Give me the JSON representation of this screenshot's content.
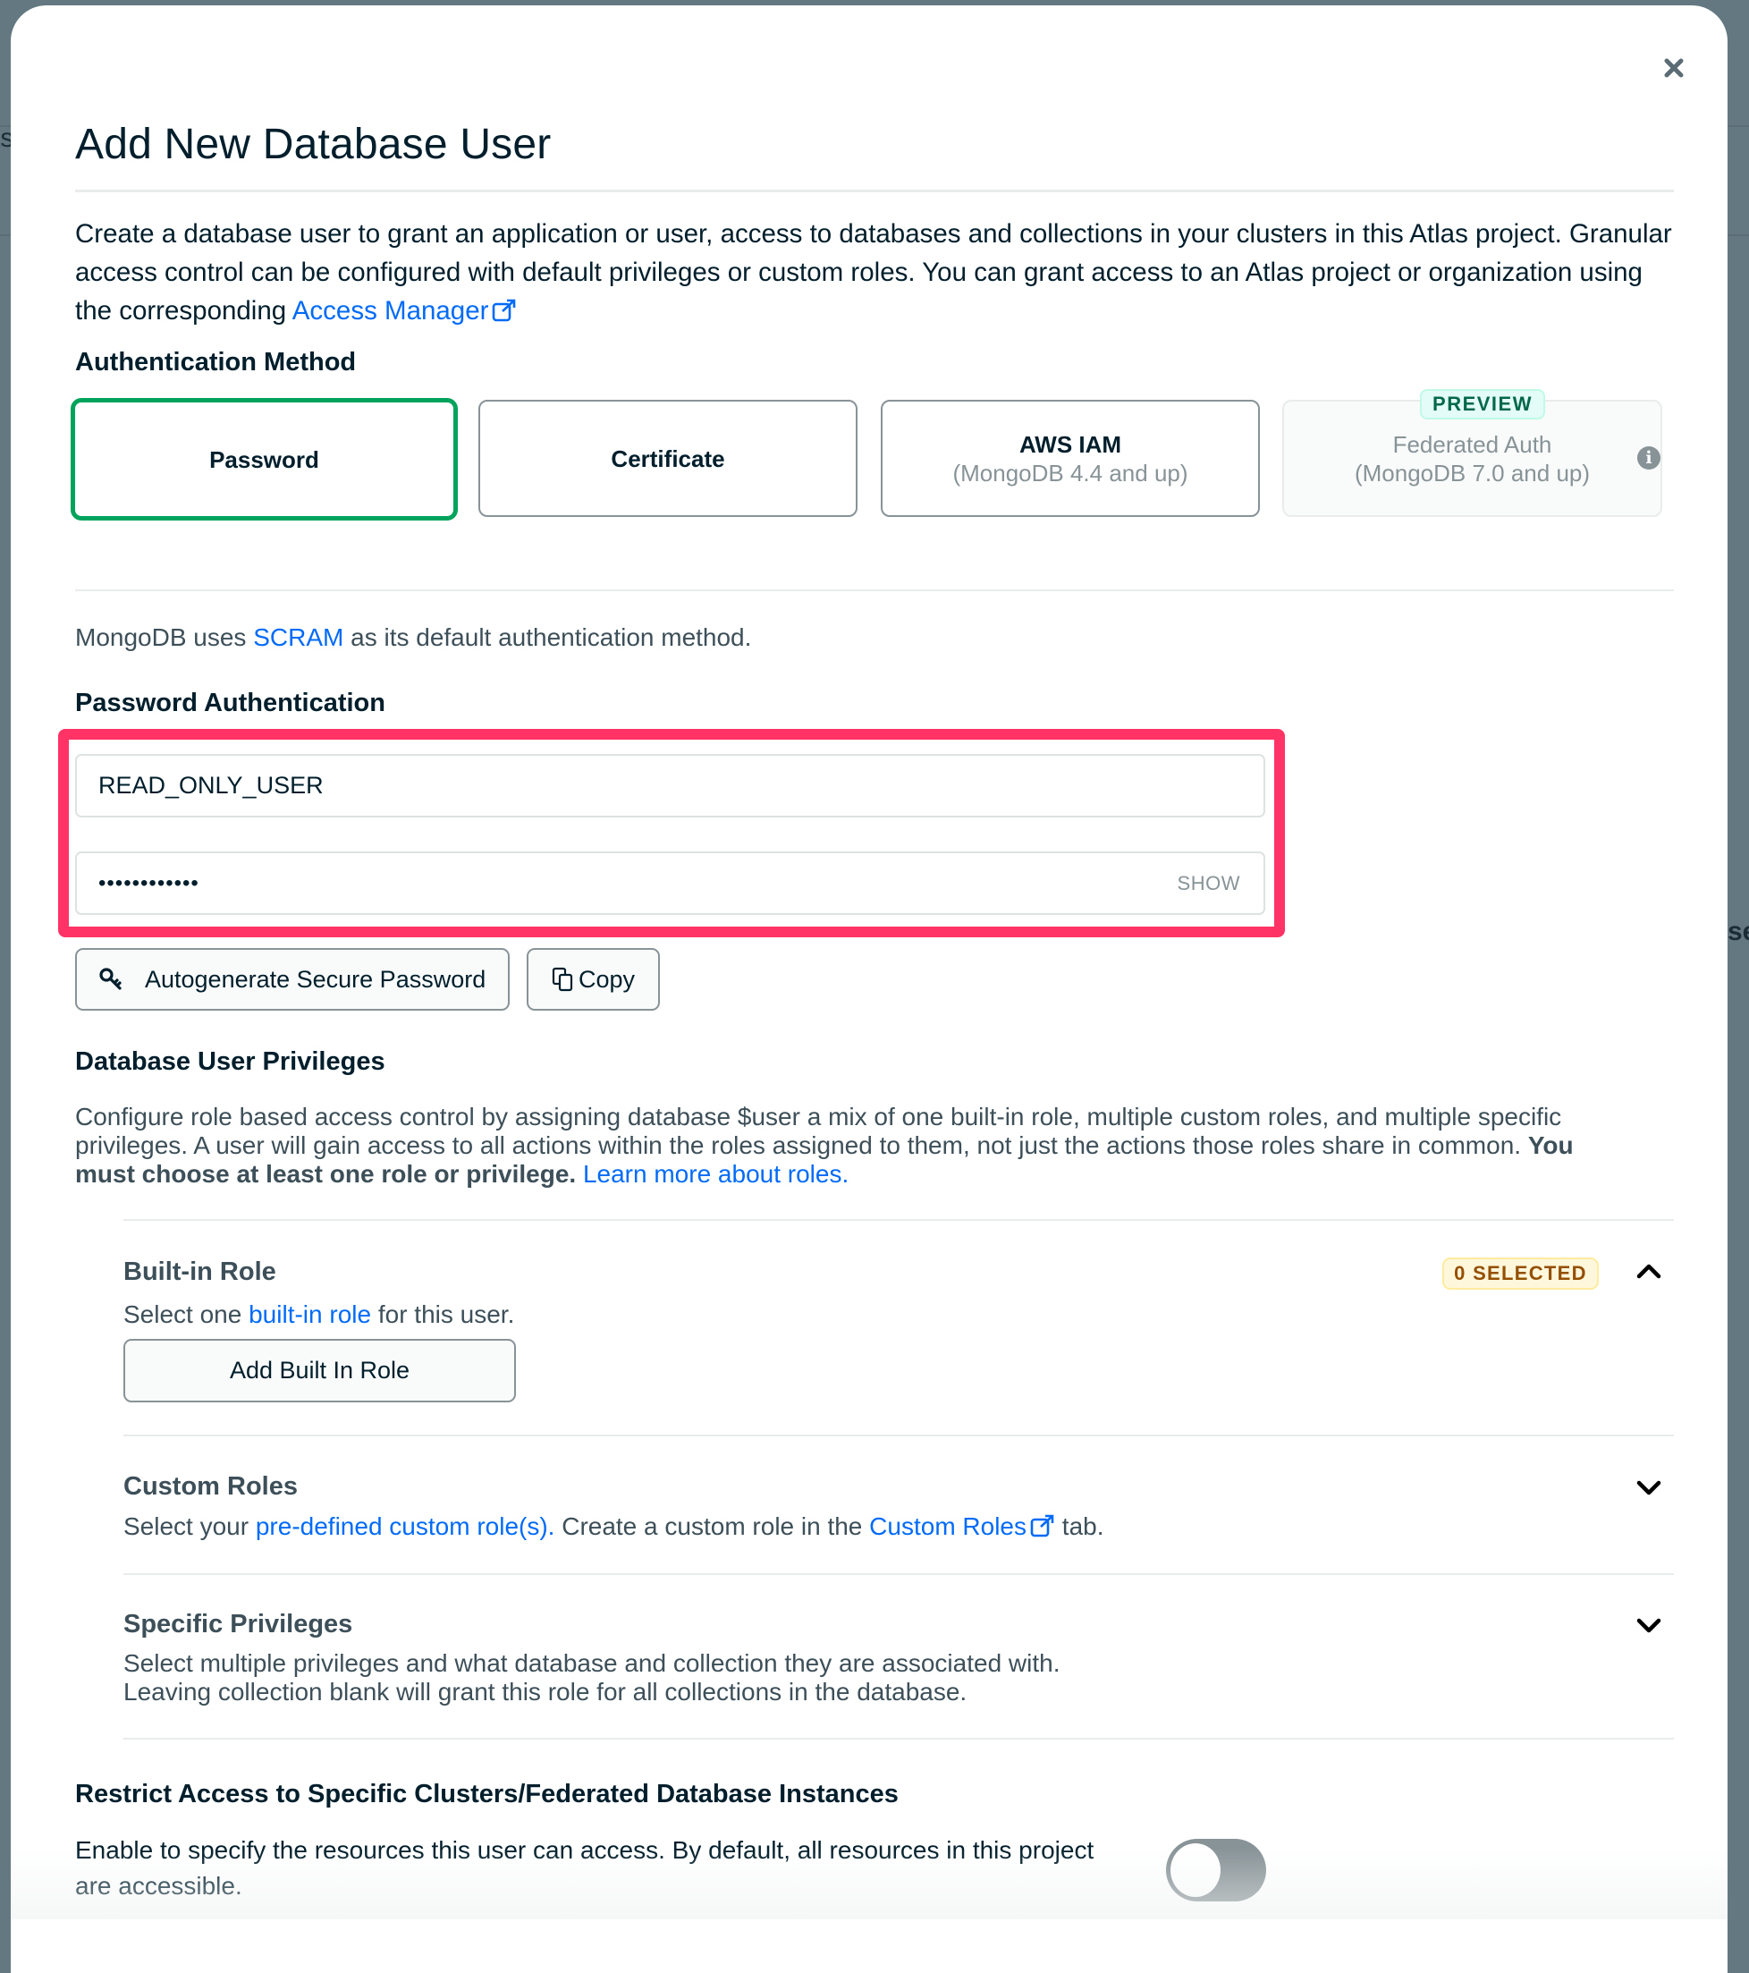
{
  "background": {
    "left_peek_text": "ts",
    "right_peek_text": "se"
  },
  "modal": {
    "title": "Add New Database User",
    "close_icon": "close-icon",
    "intro": {
      "text": "Create a database user to grant an application or user, access to databases and collections in your clusters in this Atlas project. Granular access control can be configured with default privileges or custom roles. You can grant access to an Atlas project or organization using the corresponding ",
      "link": "Access Manager",
      "link_icon": "external-link-icon"
    },
    "auth_method": {
      "heading": "Authentication Method",
      "options": [
        {
          "label": "Password",
          "sublabel": "",
          "selected": true,
          "disabled": false
        },
        {
          "label": "Certificate",
          "sublabel": "",
          "selected": false,
          "disabled": false
        },
        {
          "label": "AWS IAM",
          "sublabel": "(MongoDB 4.4 and up)",
          "selected": false,
          "disabled": false
        },
        {
          "label": "Federated Auth",
          "sublabel": "(MongoDB 7.0 and up)",
          "selected": false,
          "disabled": true,
          "badge": "PREVIEW",
          "info_icon": "info-icon"
        }
      ]
    },
    "scram_note": {
      "prefix": "MongoDB uses ",
      "link": "SCRAM",
      "suffix": " as its default authentication method."
    },
    "password_auth": {
      "heading": "Password Authentication",
      "username_value": "READ_ONLY_USER",
      "password_value": "••••••••••••",
      "show_label": "SHOW",
      "autogenerate_label": "Autogenerate Secure Password",
      "autogenerate_icon": "key-icon",
      "copy_label": "Copy",
      "copy_icon": "copy-icon",
      "highlight_color": "#ff3366"
    },
    "privileges": {
      "heading": "Database User Privileges",
      "desc_line1": "Configure role based access control by assigning database $user a mix of one built-in role, multiple custom roles, and multiple specific",
      "desc_line2_plain": "privileges. A user will gain access to all actions within the roles assigned to them, not just the actions those roles share in common. ",
      "desc_line2_bold": "You",
      "desc_line3_bold": "must choose at least one role or privilege.",
      "desc_link": "Learn more about roles.",
      "sections": {
        "builtin": {
          "title": "Built-in Role",
          "sub_prefix": "Select one ",
          "sub_link": "built-in role",
          "sub_suffix": " for this user.",
          "button": "Add Built In Role",
          "badge": "0 SELECTED",
          "expanded": true
        },
        "custom": {
          "title": "Custom Roles",
          "sub_prefix": "Select your ",
          "sub_link": "pre-defined custom role(s).",
          "sub_middle": " Create a custom role in the ",
          "sub_link2": "Custom Roles",
          "sub_suffix": " tab.",
          "expanded": false
        },
        "specific": {
          "title": "Specific Privileges",
          "line1": "Select multiple privileges and what database and collection they are associated with.",
          "line2": "Leaving collection blank will grant this role for all collections in the database.",
          "expanded": false
        }
      }
    },
    "restrict": {
      "heading": "Restrict Access to Specific Clusters/Federated Database Instances",
      "line1": "Enable to specify the resources this user can access. By default, all resources in this project",
      "line2": "are accessible.",
      "toggle_on": false
    }
  },
  "colors": {
    "selected_border": "#00a35c",
    "link": "#016bf8",
    "highlight": "#ff3366",
    "badge_preview_text": "#00684a",
    "badge_selected_text": "#944f01"
  }
}
